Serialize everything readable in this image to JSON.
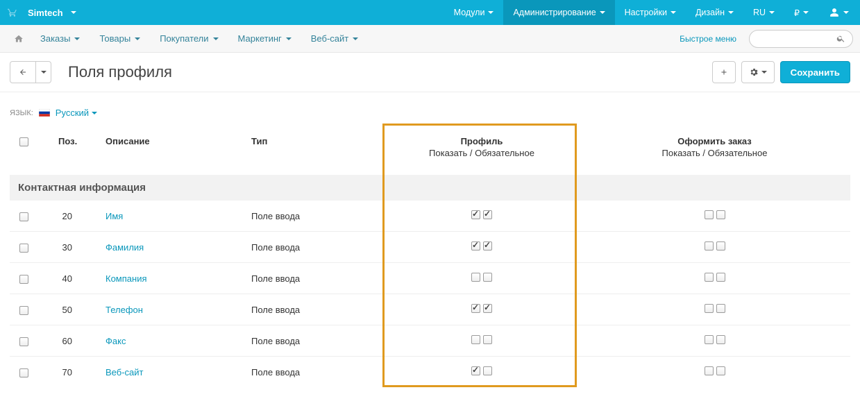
{
  "topbar": {
    "brand": "Simtech",
    "menu": {
      "modules": "Модули",
      "admin": "Администрирование",
      "settings": "Настройки",
      "design": "Дизайн",
      "lang": "RU",
      "currency": "₽"
    }
  },
  "secnav": {
    "orders": "Заказы",
    "products": "Товары",
    "customers": "Покупатели",
    "marketing": "Маркетинг",
    "website": "Веб-сайт",
    "quick_menu": "Быстрое меню"
  },
  "page": {
    "title": "Поля профиля",
    "save": "Сохранить"
  },
  "lang": {
    "label": "ЯЗЫК:",
    "current": "Русский"
  },
  "table": {
    "headers": {
      "pos": "Поз.",
      "desc": "Описание",
      "type": "Тип",
      "profile": "Профиль",
      "profile_sub": "Показать / Обязательное",
      "checkout": "Оформить заказ",
      "checkout_sub": "Показать / Обязательное"
    },
    "section": "Контактная информация",
    "rows": [
      {
        "pos": "20",
        "desc": "Имя",
        "type": "Поле ввода",
        "p_show": true,
        "p_req": true,
        "c_show": false,
        "c_req": false
      },
      {
        "pos": "30",
        "desc": "Фамилия",
        "type": "Поле ввода",
        "p_show": true,
        "p_req": true,
        "c_show": false,
        "c_req": false
      },
      {
        "pos": "40",
        "desc": "Компания",
        "type": "Поле ввода",
        "p_show": false,
        "p_req": false,
        "c_show": false,
        "c_req": false
      },
      {
        "pos": "50",
        "desc": "Телефон",
        "type": "Поле ввода",
        "p_show": true,
        "p_req": true,
        "c_show": false,
        "c_req": false
      },
      {
        "pos": "60",
        "desc": "Факс",
        "type": "Поле ввода",
        "p_show": false,
        "p_req": false,
        "c_show": false,
        "c_req": false
      },
      {
        "pos": "70",
        "desc": "Веб-сайт",
        "type": "Поле ввода",
        "p_show": true,
        "p_req": false,
        "c_show": false,
        "c_req": false
      }
    ]
  }
}
